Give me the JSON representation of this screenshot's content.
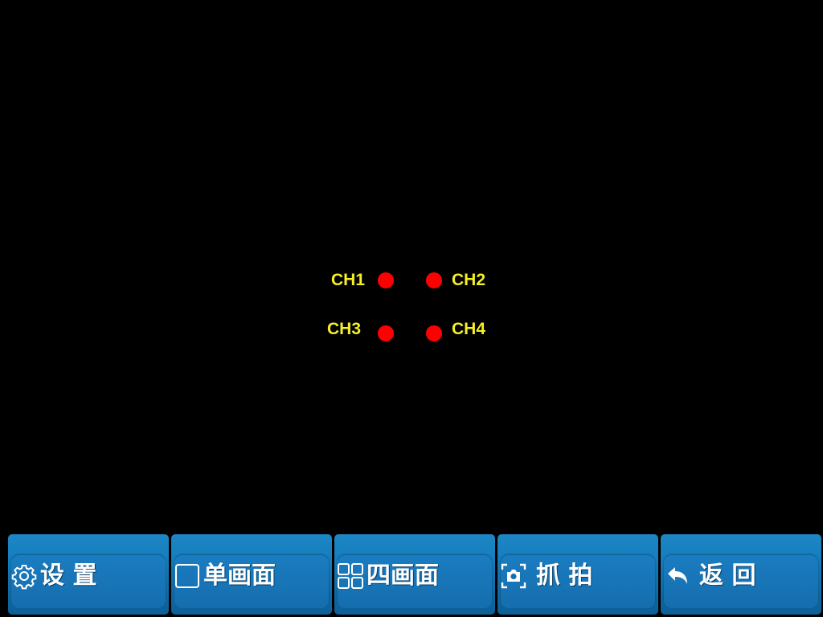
{
  "channels": [
    {
      "label": "CH1",
      "status_color": "#ff0000"
    },
    {
      "label": "CH2",
      "status_color": "#ff0000"
    },
    {
      "label": "CH3",
      "status_color": "#ff0000"
    },
    {
      "label": "CH4",
      "status_color": "#ff0000"
    }
  ],
  "toolbar": {
    "buttons": [
      {
        "label": "设 置",
        "icon": "gear-icon"
      },
      {
        "label": "单画面",
        "icon": "single-screen-icon"
      },
      {
        "label": "四画面",
        "icon": "quad-screen-icon"
      },
      {
        "label": "抓 拍",
        "icon": "camera-icon"
      },
      {
        "label": "返 回",
        "icon": "back-arrow-icon"
      }
    ]
  },
  "colors": {
    "background": "#000000",
    "channel_label": "#f5ef24",
    "status_dot": "#ff0000",
    "button_blue": "#1680c0"
  }
}
